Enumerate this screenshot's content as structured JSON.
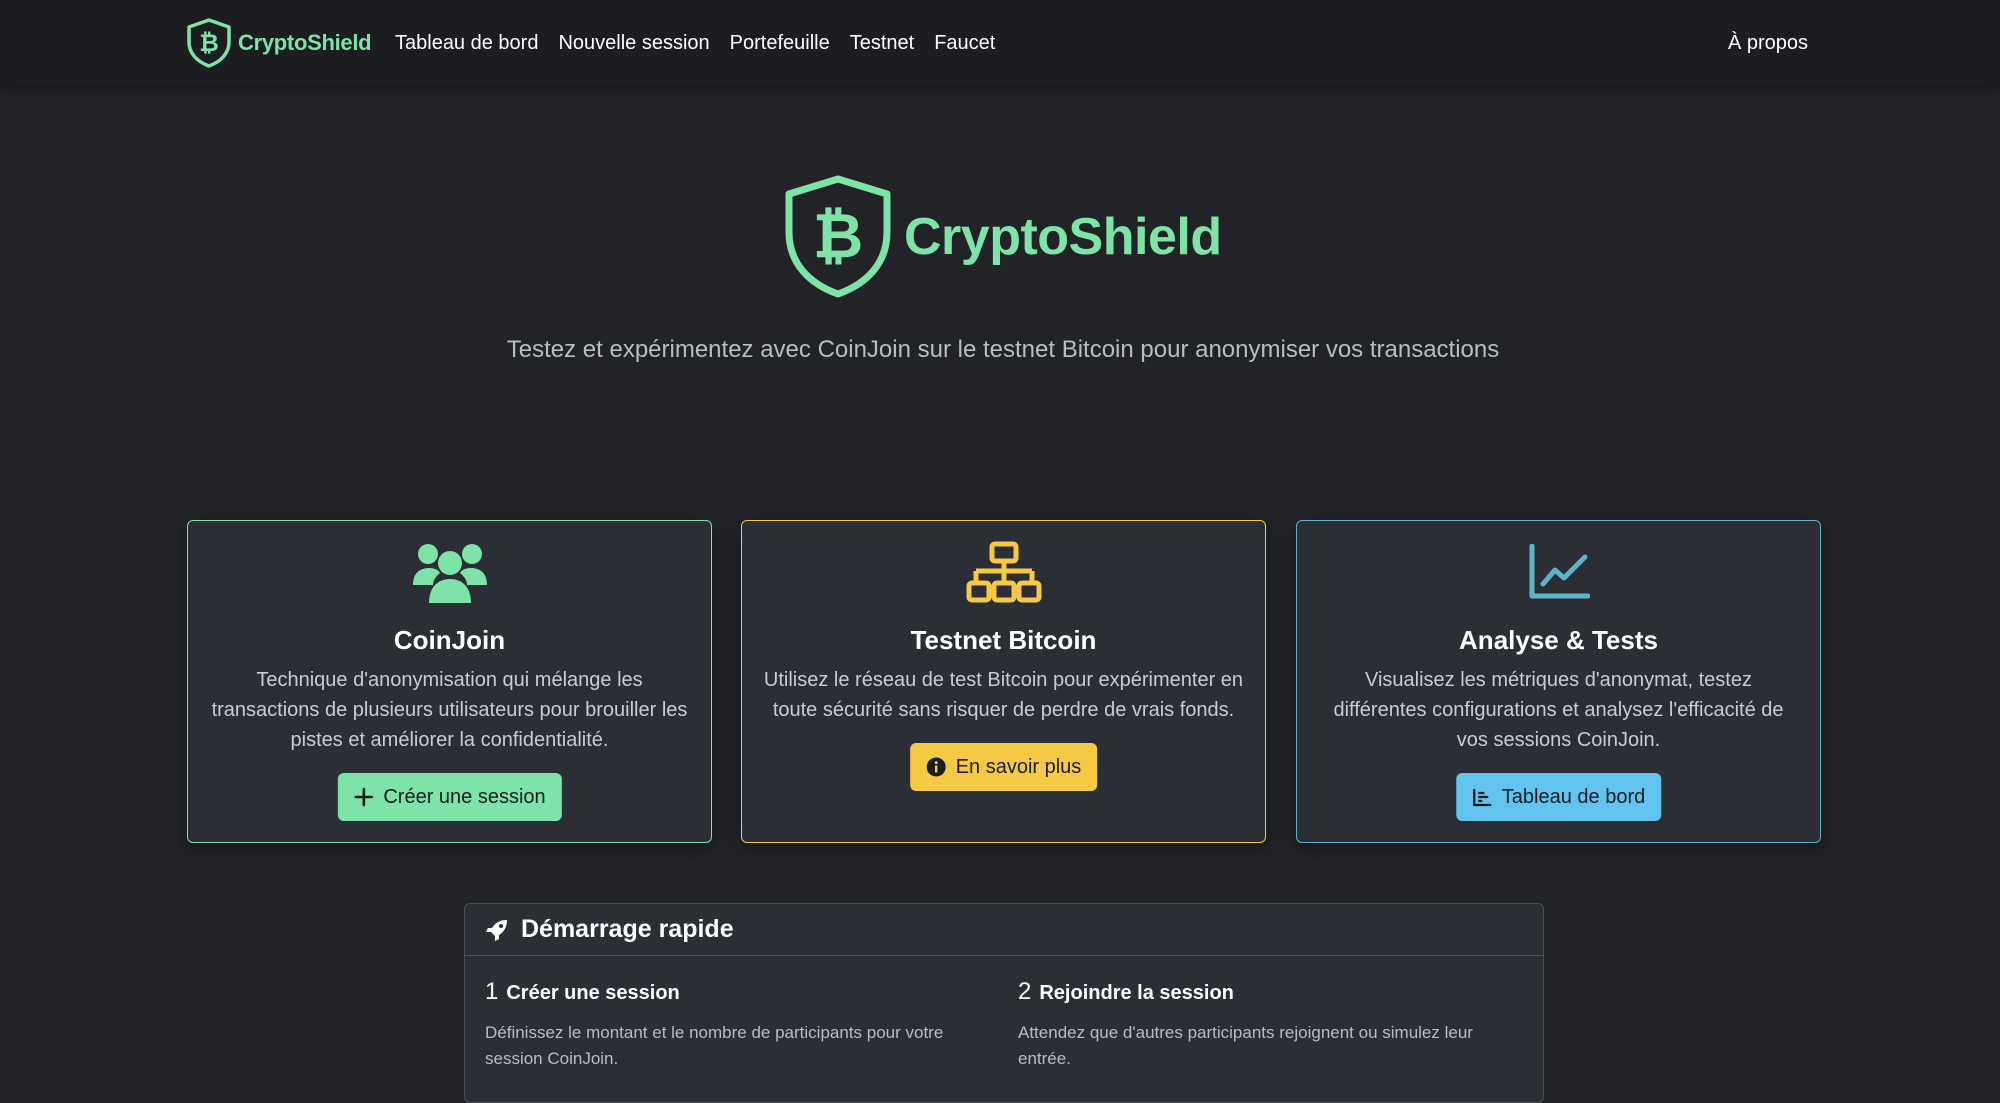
{
  "navbar": {
    "brand": "CryptoShield",
    "links": [
      "Tableau de bord",
      "Nouvelle session",
      "Portefeuille",
      "Testnet",
      "Faucet"
    ],
    "right_link": "À propos"
  },
  "hero": {
    "title": "CryptoShield",
    "subtitle": "Testez et expérimentez avec CoinJoin sur le testnet Bitcoin pour anonymiser vos transactions"
  },
  "cards": [
    {
      "icon": "users-icon",
      "title": "CoinJoin",
      "text": "Technique d'anonymisation qui mélange les transactions de plusieurs utilisateurs pour brouiller les pistes et améliorer la confidentialité.",
      "button": "Créer une session",
      "accent": "#7ee3a6"
    },
    {
      "icon": "network-icon",
      "title": "Testnet Bitcoin",
      "text": "Utilisez le réseau de test Bitcoin pour expérimenter en toute sécurité sans risquer de perdre de vrais fonds.",
      "button": "En savoir plus",
      "accent": "#f6c945"
    },
    {
      "icon": "chart-line-icon",
      "title": "Analyse & Tests",
      "text": "Visualisez les métriques d'anonymat, testez différentes configurations et analysez l'efficacité de vos sessions CoinJoin.",
      "button": "Tableau de bord",
      "accent": "#62c3ee"
    }
  ],
  "quickstart": {
    "title": "Démarrage rapide",
    "steps": [
      {
        "num": "1",
        "title": "Créer une session",
        "text": "Définissez le montant et le nombre de participants pour votre session CoinJoin."
      },
      {
        "num": "2",
        "title": "Rejoindre la session",
        "text": "Attendez que d'autres participants rejoignent ou simulez leur entrée."
      }
    ]
  }
}
